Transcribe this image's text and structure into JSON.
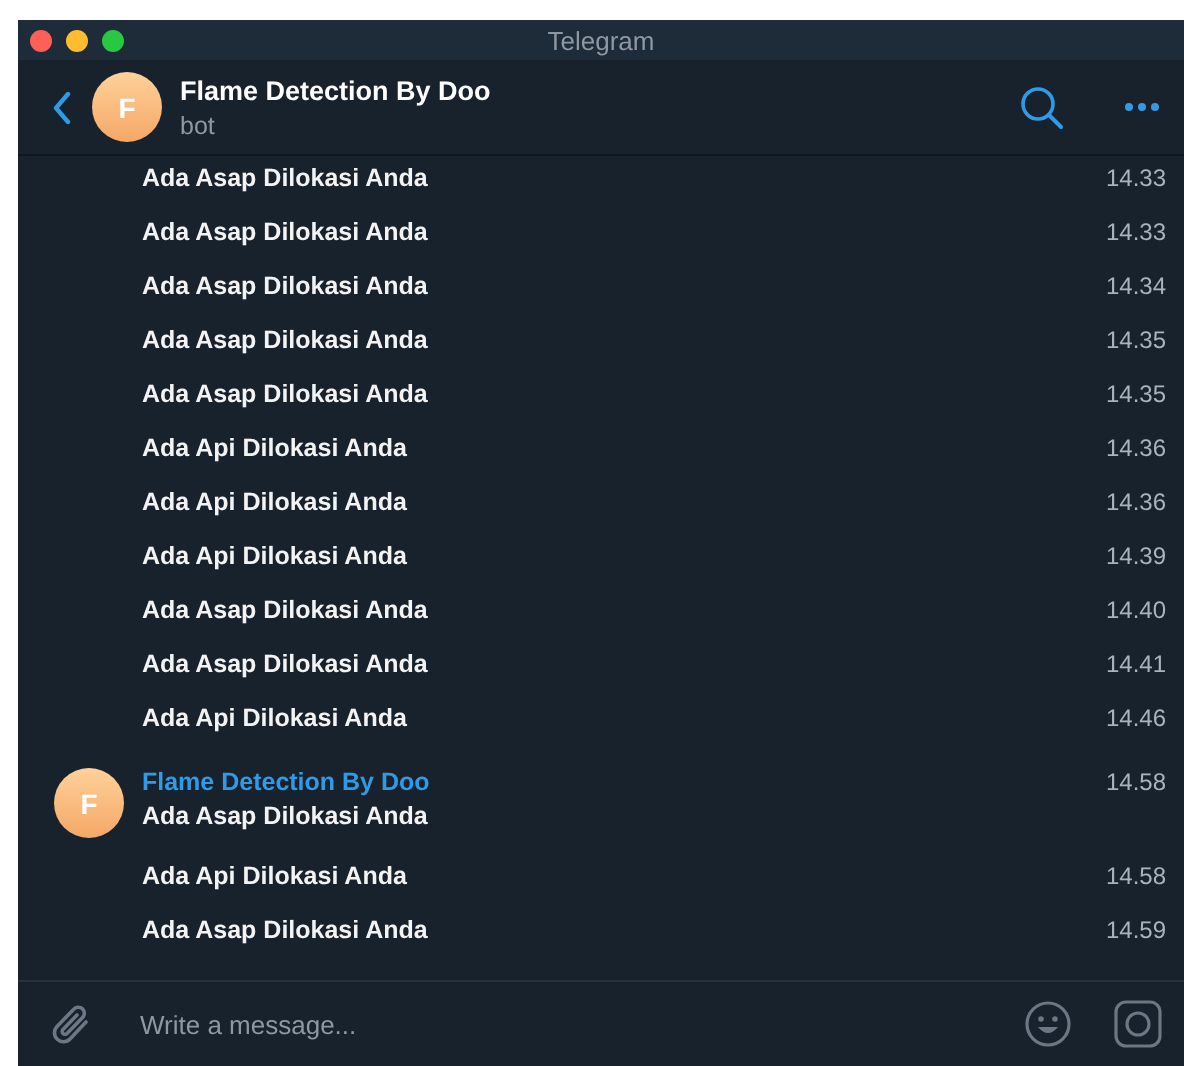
{
  "window": {
    "title": "Telegram"
  },
  "chat": {
    "name": "Flame Detection By Doo",
    "status": "bot",
    "avatar": "F"
  },
  "messages": [
    {
      "text": "Ada Asap Dilokasi Anda",
      "time": "14.33"
    },
    {
      "text": "Ada Asap Dilokasi Anda",
      "time": "14.33"
    },
    {
      "text": "Ada Asap Dilokasi Anda",
      "time": "14.34"
    },
    {
      "text": "Ada Asap Dilokasi Anda",
      "time": "14.35"
    },
    {
      "text": "Ada Asap Dilokasi Anda",
      "time": "14.35"
    },
    {
      "text": "Ada Api Dilokasi Anda",
      "time": "14.36"
    },
    {
      "text": "Ada Api Dilokasi Anda",
      "time": "14.36"
    },
    {
      "text": "Ada Api Dilokasi Anda",
      "time": "14.39"
    },
    {
      "text": "Ada Asap Dilokasi Anda",
      "time": "14.40"
    },
    {
      "text": "Ada Asap Dilokasi Anda",
      "time": "14.41"
    },
    {
      "text": "Ada Api Dilokasi Anda",
      "time": "14.46"
    },
    {
      "sender": "Flame Detection By Doo",
      "avatar": "F",
      "text": "Ada Asap Dilokasi Anda",
      "time": "14.58"
    },
    {
      "text": "Ada Api Dilokasi Anda",
      "time": "14.58"
    },
    {
      "text": "Ada Asap Dilokasi Anda",
      "time": "14.59"
    }
  ],
  "composer": {
    "placeholder": "Write a message..."
  }
}
